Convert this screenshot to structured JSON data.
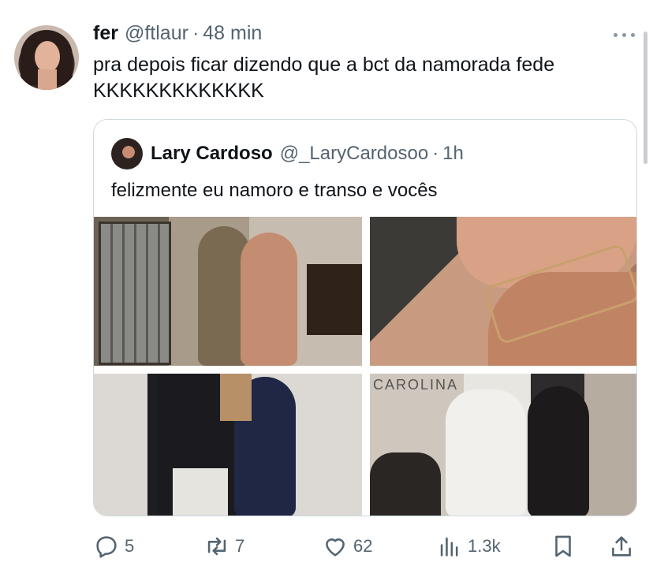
{
  "tweet": {
    "author_name": "fer",
    "author_handle": "@ftlaur",
    "separator": "·",
    "time": "48 min",
    "text": "pra depois ficar dizendo que a bct da namorada fede KKKKKKKKKKKKK"
  },
  "quoted": {
    "author_name": "Lary Cardoso",
    "author_handle": "@_LaryCardosoo",
    "separator": "·",
    "time": "1h",
    "text": "felizmente eu namoro e transo e vocês",
    "photo4_caption": "CAROLINA"
  },
  "actions": {
    "replies": "5",
    "reposts": "7",
    "likes": "62",
    "views": "1.3k"
  },
  "icons": {
    "reply": "reply-icon",
    "repost": "repost-icon",
    "like": "heart-icon",
    "views": "views-icon",
    "bookmark": "bookmark-icon",
    "share": "share-icon",
    "more": "more-icon"
  }
}
